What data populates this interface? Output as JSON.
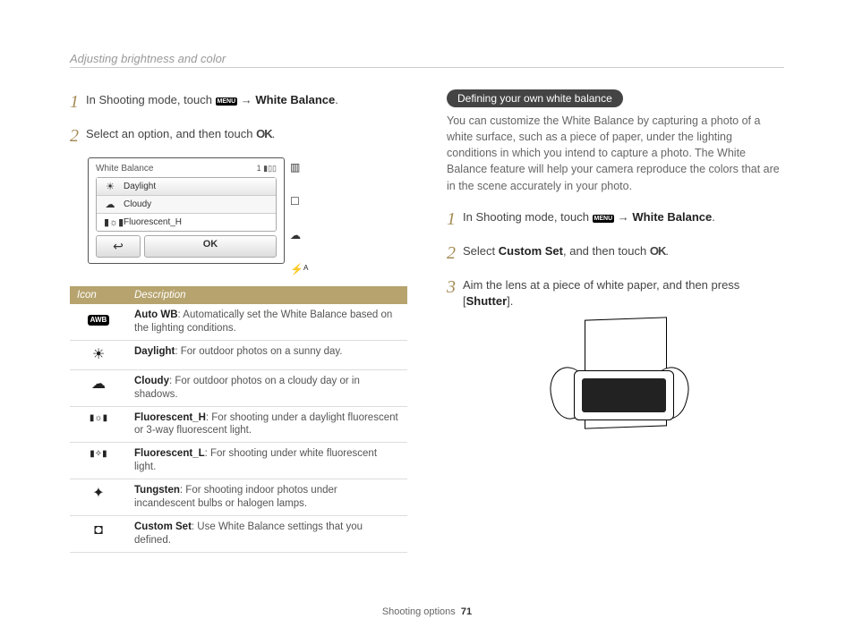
{
  "header": "Adjusting brightness and color",
  "left": {
    "step1_a": "In Shooting mode, touch ",
    "step1_b": " → ",
    "step1_c": "White Balance",
    "step1_d": ".",
    "step2_a": "Select an option, and then touch ",
    "step2_b": ".",
    "ok": "OK",
    "menu": "MENU",
    "wb": {
      "title": "White Balance",
      "count": "1",
      "items": [
        "Daylight",
        "Cloudy",
        "Fluorescent_H"
      ],
      "back": "↩",
      "ok": "OK"
    },
    "table": {
      "h1": "Icon",
      "h2": "Description",
      "rows": [
        {
          "iconText": "AWB",
          "title": "Auto WB",
          "desc": ": Automatically set the White Balance based on the lighting conditions."
        },
        {
          "iconGlyph": "☀",
          "title": "Daylight",
          "desc": ": For outdoor photos on a sunny day."
        },
        {
          "iconGlyph": "☁",
          "title": "Cloudy",
          "desc": ": For outdoor photos on a cloudy day or in shadows."
        },
        {
          "iconGlyph": "▮☼▮",
          "title": "Fluorescent_H",
          "desc": ": For shooting under a daylight fluorescent or 3-way fluorescent light."
        },
        {
          "iconGlyph": "▮✧▮",
          "title": "Fluorescent_L",
          "desc": ": For shooting under white fluorescent light."
        },
        {
          "iconGlyph": "✦",
          "title": "Tungsten",
          "desc": ": For shooting indoor photos under incandescent bulbs or halogen lamps."
        },
        {
          "iconGlyph": "◘",
          "title": "Custom Set",
          "desc": ": Use White Balance settings that you defined."
        }
      ]
    }
  },
  "right": {
    "pill": "Defining your own white balance",
    "para": "You can customize the White Balance by capturing a photo of a white surface, such as a piece of paper, under the lighting conditions in which you intend to capture a photo. The White Balance feature will help your camera reproduce the colors that are in the scene accurately in your photo.",
    "step1_a": "In Shooting mode, touch ",
    "step1_b": " → ",
    "step1_c": "White Balance",
    "step1_d": ".",
    "step2_a": "Select ",
    "step2_b": "Custom Set",
    "step2_c": ", and then touch ",
    "step2_d": ".",
    "step3_a": "Aim the lens at a piece of white paper, and then press [",
    "step3_b": "Shutter",
    "step3_c": "]."
  },
  "footer": {
    "section": "Shooting options",
    "page": "71"
  },
  "nums": {
    "n1": "1",
    "n2": "2",
    "n3": "3"
  }
}
